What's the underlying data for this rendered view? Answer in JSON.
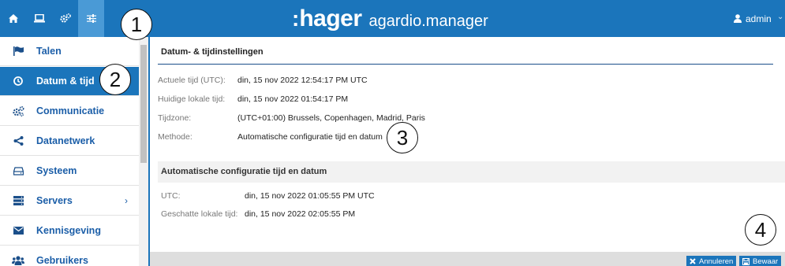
{
  "header": {
    "icons": [
      "home-icon",
      "laptop-icon",
      "cogs-icon",
      "sliders-icon"
    ],
    "brand_colon": ":",
    "brand_name": "hager",
    "product": "agardio.manager",
    "user": "admin",
    "user_chevron": "⌄"
  },
  "sidebar": {
    "items": [
      {
        "label": "Talen",
        "icon": "flag-icon"
      },
      {
        "label": "Datum & tijd",
        "icon": "clock-icon",
        "active": true
      },
      {
        "label": "Communicatie",
        "icon": "cogs-icon"
      },
      {
        "label": "Datanetwerk",
        "icon": "share-icon"
      },
      {
        "label": "Systeem",
        "icon": "hdd-icon"
      },
      {
        "label": "Servers",
        "icon": "server-icon",
        "chevron": "›"
      },
      {
        "label": "Kennisgeving",
        "icon": "envelope-icon"
      },
      {
        "label": "Gebruikers",
        "icon": "users-icon"
      }
    ]
  },
  "main": {
    "title": "Datum- & tijdinstellingen",
    "rows": [
      {
        "label": "Actuele tijd (UTC):",
        "value": "din, 15 nov 2022 12:54:17 PM UTC"
      },
      {
        "label": "Huidige lokale tijd:",
        "value": "din, 15 nov 2022 01:54:17 PM"
      },
      {
        "label": "Tijdzone:",
        "value": "(UTC+01:00) Brussels, Copenhagen, Madrid, Paris"
      },
      {
        "label": "Methode:",
        "value": "Automatische configuratie tijd en datum"
      }
    ],
    "sub_title": "Automatische configuratie tijd en datum",
    "sub_rows": [
      {
        "label": "UTC:",
        "value": "din, 15 nov 2022 01:05:55 PM UTC"
      },
      {
        "label": "Geschatte lokale tijd:",
        "value": "din, 15 nov 2022 02:05:55 PM"
      }
    ]
  },
  "footer": {
    "cancel_label": "Annuleren",
    "save_label": "Bewaar"
  },
  "callouts": [
    "1",
    "2",
    "3",
    "4"
  ],
  "colors": {
    "primary": "#1b75bb",
    "active_tab": "#4a9ad6",
    "link": "#1b5ea8"
  }
}
